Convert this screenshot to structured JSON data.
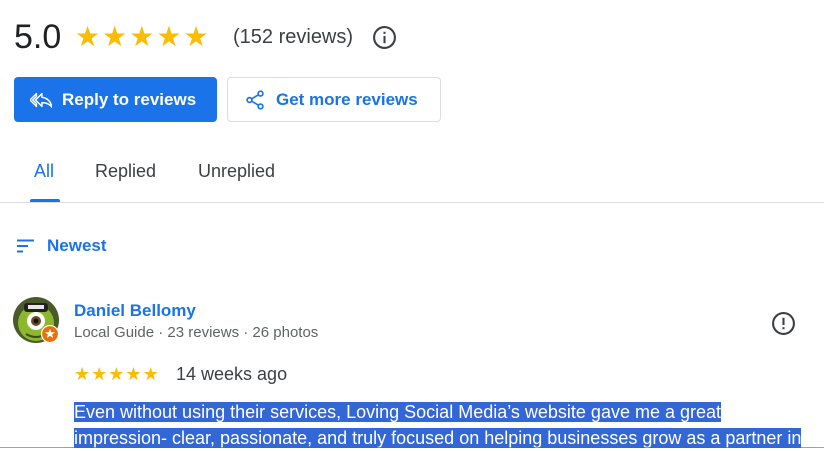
{
  "rating": {
    "score": "5.0",
    "stars": [
      "★",
      "★",
      "★",
      "★",
      "★"
    ],
    "count_text": "(152 reviews)"
  },
  "buttons": {
    "reply": "Reply to reviews",
    "more": "Get more reviews"
  },
  "tabs": {
    "all": "All",
    "replied": "Replied",
    "unreplied": "Unreplied",
    "active": "All"
  },
  "sort": {
    "label": "Newest"
  },
  "review": {
    "name": "Daniel Bellomy",
    "meta": "Local Guide · 23 reviews · 26 photos",
    "stars": [
      "★",
      "★",
      "★",
      "★",
      "★"
    ],
    "date": "14 weeks ago",
    "text_line1": "Even without using their services, Loving Social Media’s website gave me a great",
    "text_line2": "impression- clear, passionate, and truly focused on helping businesses grow as a partner in"
  },
  "colors": {
    "accent": "#1a73e8",
    "star": "#fbbc04",
    "selection": "#3367d6"
  },
  "icons": {
    "info": "info-icon",
    "reply": "reply-all-icon",
    "share": "share-icon",
    "sort": "sort-icon",
    "flag": "flag-icon",
    "badge": "local-guide-badge-icon"
  }
}
